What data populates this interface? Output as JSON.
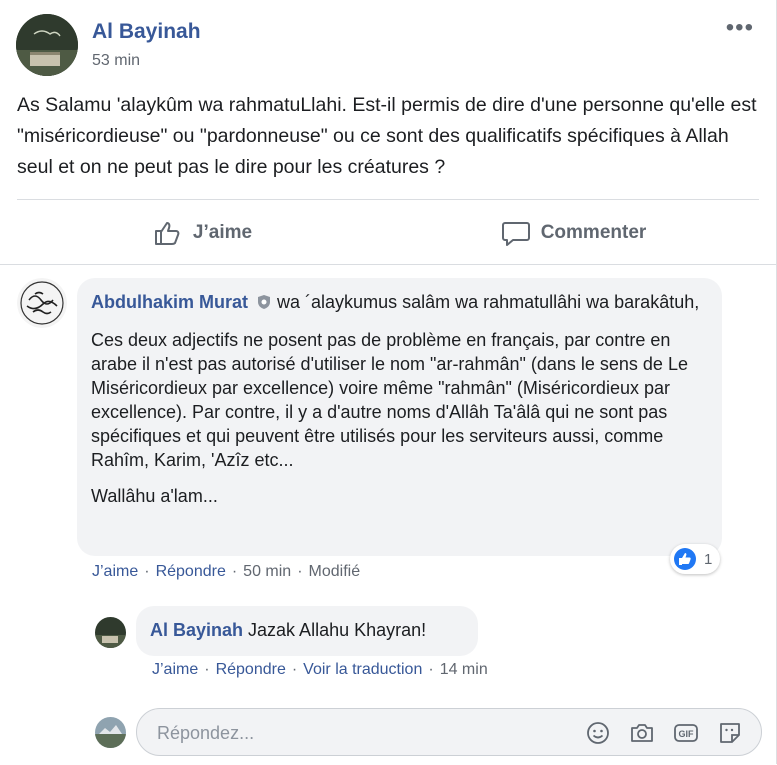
{
  "post": {
    "author": "Al Bayinah",
    "time": "53 min",
    "more_icon": "•••",
    "text": "As Salamu 'alaykûm wa rahmatuLlahi. Est-il permis de dire d'une personne qu'elle est \"miséricordieuse\" ou \"pardonneuse\" ou ce sont des qualificatifs spécifiques à Allah seul et on ne peut pas le dire pour les créatures ?",
    "like_label": "J’aime",
    "comment_label": "Commenter"
  },
  "comments": [
    {
      "author": "Abdulhakim Murat",
      "first_line": " wa ´alaykumus salâm wa rahmatullâhi wa barakâtuh,",
      "paragraph": "Ces deux adjectifs ne posent pas de problème en français, par contre en arabe il n'est pas autorisé d'utiliser le nom \"ar-rahmân\" (dans le sens de Le Miséricordieux par excellence) voire même \"rahmân\" (Miséricordieux par excellence). Par contre, il y a d'autre noms d'Allâh Ta'âlâ qui ne sont pas spécifiques et qui peuvent être utilisés pour les serviteurs aussi, comme Rahîm, Karim, 'Azîz etc...",
      "closing": "Wallâhu a'lam...",
      "like": "J’aime",
      "reply": "Répondre",
      "time": "50 min",
      "edited": "Modifié",
      "reaction_count": "1"
    },
    {
      "author": "Al Bayinah",
      "text": " Jazak Allahu Khayran!",
      "like": "J’aime",
      "reply": "Répondre",
      "translate": "Voir la traduction",
      "time": "14 min"
    }
  ],
  "reply_input": {
    "placeholder": "Répondez..."
  },
  "separator": "·",
  "colors": {
    "link": "#385898",
    "like_blue": "#2078f4",
    "bubble_bg": "#f2f3f5"
  }
}
